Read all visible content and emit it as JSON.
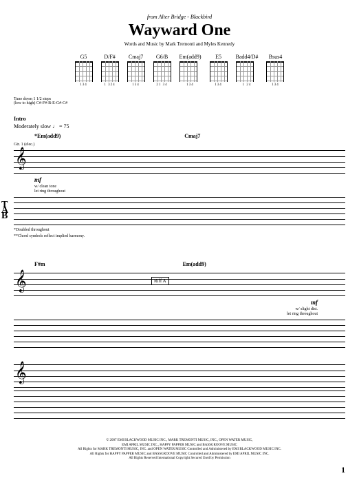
{
  "header": {
    "subtitle": "from Alter Bridge - Blackbird",
    "title": "Wayward One",
    "credits": "Words and Music by Mark Tremonti and Myles Kennedy"
  },
  "chords": [
    {
      "name": "G5",
      "fingering": "134"
    },
    {
      "name": "D/F#",
      "fingering": "1 324"
    },
    {
      "name": "Cmaj7",
      "fingering": "134"
    },
    {
      "name": "G6/B",
      "fingering": "21 34"
    },
    {
      "name": "Em(add9)",
      "fingering": "134"
    },
    {
      "name": "E5",
      "fingering": "134"
    },
    {
      "name": "Badd4/D#",
      "fingering": "1 24"
    },
    {
      "name": "Bsus4",
      "fingering": "134"
    }
  ],
  "tuning": {
    "line1": "Tune down 1 1/2 steps",
    "line2": "(low to high) C#-F#-B-E-G#-C#"
  },
  "intro": {
    "section": "Intro",
    "tempo": "Moderately slow ♩ = 75",
    "chord_marker": "*Em(add9)",
    "gtr_label": "Gtr. 1 (elec.)",
    "dynamic": "mf",
    "inst1": "w/ clean tone",
    "inst2": "let ring throughout",
    "footnote1": "*Doubled throughout",
    "footnote2": "**Chord symbols reflect implied harmony."
  },
  "system1_chord2": "Cmaj7",
  "system2": {
    "chord1": "F#m",
    "chord2": "Em(add9)",
    "riff_box": "Riff A",
    "dynamic": "mf",
    "inst1": "w/ slight dist.",
    "inst2": "let ring throughout"
  },
  "copyright": {
    "l1": "© 2007 EMI BLACKWOOD MUSIC INC., MARK TREMONTI MUSIC, INC., OPEN WATER MUSIC,",
    "l2": "EMI APRIL MUSIC INC., HAPPY PAPPER MUSIC and BASSGROOVE MUSIC",
    "l3": "All Rights for MARK TREMONTI MUSIC, INC. and OPEN WATER MUSIC Controlled and Administered by EMI BLACKWOOD MUSIC INC.",
    "l4": "All Rights for HAPPY PAPPER MUSIC and BASSGROOVE MUSIC Controlled and Administered by EMI APRIL MUSIC INC.",
    "l5": "All Rights Reserved   International Copyright Secured   Used by Permission"
  },
  "page": "1"
}
